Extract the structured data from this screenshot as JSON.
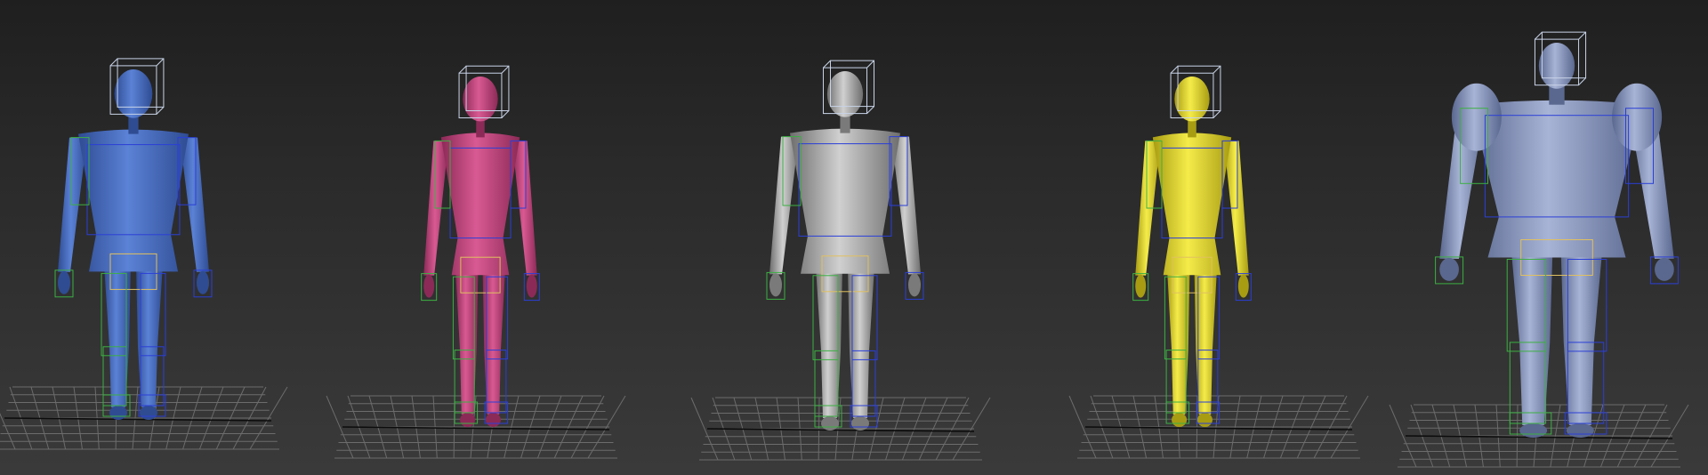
{
  "viewport": {
    "background_top": "#1f1f1f",
    "background_bottom": "#3a3a3a",
    "grid_color": "#6c6c6c"
  },
  "characters": [
    {
      "id": "male-blue",
      "color": "#4a6fc4",
      "shade": "#2f4c93"
    },
    {
      "id": "female-magenta",
      "color": "#c9457f",
      "shade": "#8c2a57"
    },
    {
      "id": "male-silver",
      "color": "#b7b7b7",
      "shade": "#7a7a7a"
    },
    {
      "id": "female-yellow",
      "color": "#e9dc2c",
      "shade": "#a89c12"
    },
    {
      "id": "brute-slate",
      "color": "#8d9bc3",
      "shade": "#5a678f"
    }
  ],
  "rig_colors": {
    "left": "#3cb043",
    "right": "#2b3fd6",
    "center": "#e0c060",
    "head_box": "#c9d4e8"
  }
}
